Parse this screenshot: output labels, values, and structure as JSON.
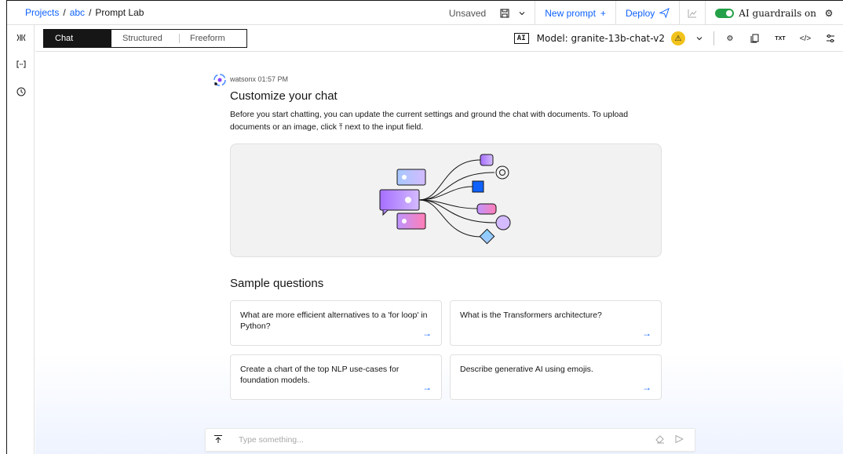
{
  "breadcrumbs": {
    "projects": "Projects",
    "sep": "/",
    "project": "abc",
    "current": "Prompt Lab"
  },
  "header": {
    "unsaved": "Unsaved",
    "new_prompt": "New prompt",
    "new_prompt_icon": "+",
    "deploy": "Deploy",
    "guardrails": "AI guardrails on",
    "guardrails_on": true
  },
  "modes": {
    "chat": "Chat",
    "structured": "Structured",
    "freeform": "Freeform",
    "active": "Chat"
  },
  "model_bar": {
    "ai_badge": "AI",
    "model_label": "Model: granite-13b-chat-v2",
    "warning": "⚠",
    "txt_icon": "TXT",
    "code_icon": "</>"
  },
  "message": {
    "sender": "watsonx 01:57 PM",
    "title": "Customize your chat",
    "body_1": "Before you start chatting, you can update the current settings and ground the chat with documents. To upload",
    "body_2a": "documents or an image, click",
    "body_icon": "⤒",
    "body_2b": "next to the input field."
  },
  "samples": {
    "heading": "Sample questions",
    "items": [
      {
        "text": "What are more efficient alternatives to a 'for loop' in Python?"
      },
      {
        "text": "What is the Transformers architecture?"
      },
      {
        "text": "Create a chart of the top NLP use-cases for foundation models."
      },
      {
        "text": "Describe generative AI using emojis."
      }
    ],
    "arrow": "→"
  },
  "input": {
    "placeholder": "Type something..."
  },
  "colors": {
    "accent": "#0f62fe",
    "toggle_on": "#24a148",
    "warning": "#f1c21b"
  }
}
